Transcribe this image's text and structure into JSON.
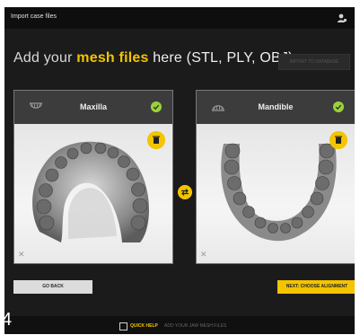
{
  "window": {
    "title": "Import case files"
  },
  "headline": {
    "prefix": "Add your ",
    "highlight": "mesh files",
    "suffix": " here (STL, PLY, OBJ)."
  },
  "import_button": {
    "label": "IMPORT TO DATABASE"
  },
  "cards": [
    {
      "label": "Maxilla"
    },
    {
      "label": "Mandible"
    }
  ],
  "buttons": {
    "go_back": "GO BACK",
    "next": "NEXT: CHOOSE ALIGNMENT"
  },
  "bottom_bar": {
    "quick_help": "QUICK HELP",
    "hint": "ADD YOUR JAW MESH FILES"
  },
  "figure_number": "4",
  "colors": {
    "accent": "#f3c400",
    "success": "#9bd13a",
    "background": "#1b1b1b"
  }
}
